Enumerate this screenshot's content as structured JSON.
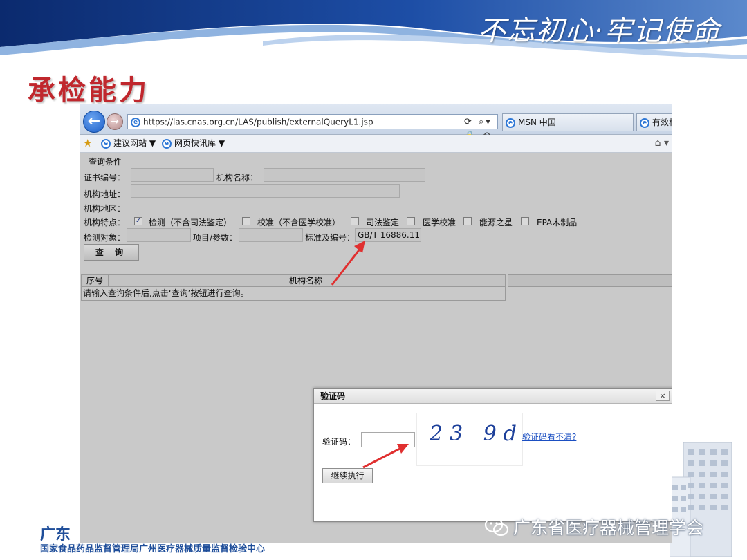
{
  "slide": {
    "slogan": "不忘初心·牢记使命",
    "title": "承检能力",
    "footer_org_short": "广东",
    "footer_org_full": "国家食品药品监督管理局广州医疗器械质量监督检验中心",
    "watermark": "广东省医疗器械管理学会"
  },
  "browser": {
    "url": "https://las.cnas.org.cn/LAS/publish/externalQueryL1.jsp",
    "url_tools": "⟳ ⌕▾ 🔒 ⟲ ✕",
    "tabs": [
      "MSN 中国",
      "有效机"
    ],
    "favorites": [
      "建议网站 ▼",
      "网页快讯库 ▼"
    ]
  },
  "form": {
    "legend": "查询条件",
    "cert_no_label": "证书编号：",
    "org_name_label": "机构名称：",
    "org_address_label": "机构地址：",
    "org_region_label": "机构地区：",
    "org_feature_label": "机构特点：",
    "features": [
      {
        "label": "检测（不含司法鉴定）",
        "checked": true
      },
      {
        "label": "校准（不含医学校准）",
        "checked": false
      },
      {
        "label": "司法鉴定",
        "checked": false
      },
      {
        "label": "医学校准",
        "checked": false
      },
      {
        "label": "能源之星",
        "checked": false
      },
      {
        "label": "EPA木制品",
        "checked": false
      }
    ],
    "test_object_label": "检测对象：",
    "item_param_label": "项目/参数：",
    "standard_label": "标准及编号：",
    "standard_value": "GB/T 16886.11",
    "query_button": "查 询"
  },
  "results": {
    "headers": [
      "序号",
      "机构名称"
    ],
    "empty_message": "请输入查询条件后,点击‘查询’按钮进行查询。"
  },
  "captcha": {
    "title": "验证码",
    "close": "×",
    "label": "验证码：",
    "input_value": "",
    "image_text": "23 9d",
    "refresh_link": "验证码看不清?",
    "continue_button": "继续执行"
  },
  "colors": {
    "title_red": "#c0272d",
    "arrow_red": "#e03030",
    "browser_gray": "#c9c9c9",
    "link_blue": "#1b4fc2"
  }
}
